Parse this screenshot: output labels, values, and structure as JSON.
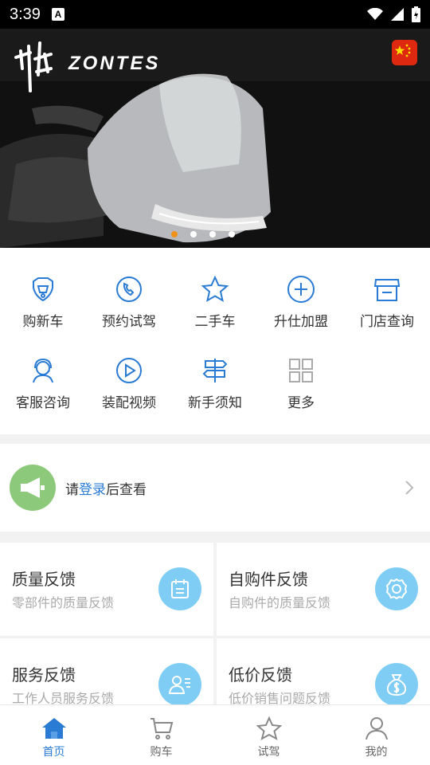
{
  "status_bar": {
    "time": "3:39",
    "notification_glyph": "A"
  },
  "banner": {
    "brand": "ZONTES",
    "logo_icon": "shengshi-logo",
    "flag_icon": "china-flag",
    "slide_count": 4,
    "active_slide": 1
  },
  "menu": {
    "items": [
      {
        "label": "购新车",
        "icon": "motorcycle-front-icon"
      },
      {
        "label": "预约试驾",
        "icon": "phone-icon"
      },
      {
        "label": "二手车",
        "icon": "star-icon"
      },
      {
        "label": "升仕加盟",
        "icon": "plus-circle-icon"
      },
      {
        "label": "门店查询",
        "icon": "store-icon"
      },
      {
        "label": "客服咨询",
        "icon": "headset-icon"
      },
      {
        "label": "装配视频",
        "icon": "play-icon"
      },
      {
        "label": "新手须知",
        "icon": "signpost-icon"
      },
      {
        "label": "更多",
        "icon": "grid-icon"
      }
    ]
  },
  "notice": {
    "prefix": "请",
    "link": "登录",
    "suffix": "后查看",
    "icon": "megaphone-icon"
  },
  "cards": [
    {
      "title": "质量反馈",
      "subtitle": "零部件的质量反馈",
      "icon": "calendar-icon"
    },
    {
      "title": "自购件反馈",
      "subtitle": "自购件的质量反馈",
      "icon": "gear-icon"
    },
    {
      "title": "服务反馈",
      "subtitle": "工作人员服务反馈",
      "icon": "person-card-icon"
    },
    {
      "title": "低价反馈",
      "subtitle": "低价销售问题反馈",
      "icon": "money-bag-icon"
    }
  ],
  "tabbar": {
    "tabs": [
      {
        "label": "首页",
        "icon": "home-icon",
        "active": true
      },
      {
        "label": "购车",
        "icon": "cart-icon",
        "active": false
      },
      {
        "label": "试驾",
        "icon": "star-icon",
        "active": false
      },
      {
        "label": "我的",
        "icon": "user-icon",
        "active": false
      }
    ]
  },
  "colors": {
    "accent": "#2a7bd4",
    "card_icon_bg": "#7fcdf5",
    "notice_icon_bg": "#8cc97a",
    "active_dot": "#f0911a"
  }
}
